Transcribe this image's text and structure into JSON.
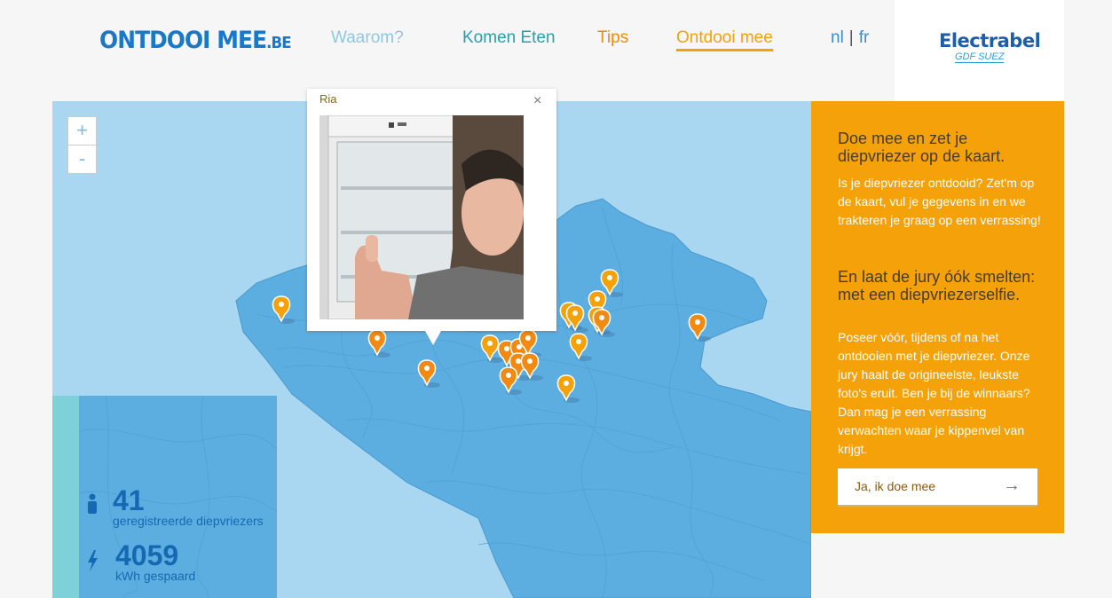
{
  "header": {
    "logo_main": "ONTDOOI MEE",
    "logo_suffix": ".BE",
    "nav": [
      {
        "label": "Waarom?",
        "color": "#8fc7e3"
      },
      {
        "label": "Komen Eten",
        "color": "#27a0ac"
      },
      {
        "label": "Tips",
        "color": "#f08a12"
      },
      {
        "label": "Ontdooi mee",
        "color": "#f5a20a"
      }
    ],
    "lang_nl": "nl",
    "lang_sep": "|",
    "lang_fr": "fr",
    "brand_name": "Electrabel",
    "brand_sub": "GDF SUEZ"
  },
  "map": {
    "zoom_in": "+",
    "zoom_out": "-",
    "marker_color_orange": "#f08a12",
    "marker_color_yellow": "#f5a20a",
    "popup": {
      "name": "Ria",
      "close": "×"
    }
  },
  "stats": {
    "freezers_count": "41",
    "freezers_label": "geregistreerde diepvriezers",
    "kwh_count": "4059",
    "kwh_label": "kWh gespaard"
  },
  "panel": {
    "heading1": "Doe mee en zet je diepvriezer op de kaart.",
    "text1": "Is je diepvriezer ontdooid? Zet'm op de kaart, vul je gegevens in en we trakteren je graag op een verrassing!",
    "heading2": "En laat de jury óók smelten: met een diepvriezerselfie.",
    "text2": "Poseer vóór, tijdens of na het ontdooien met je diepvriezer. Onze jury haalt de origineelste, leukste foto's eruit. Ben je bij de winnaars? Dan mag je een verrassing verwachten waar je kippenvel van krijgt.",
    "cta_label": "Ja, ik doe mee",
    "cta_arrow": "→"
  }
}
